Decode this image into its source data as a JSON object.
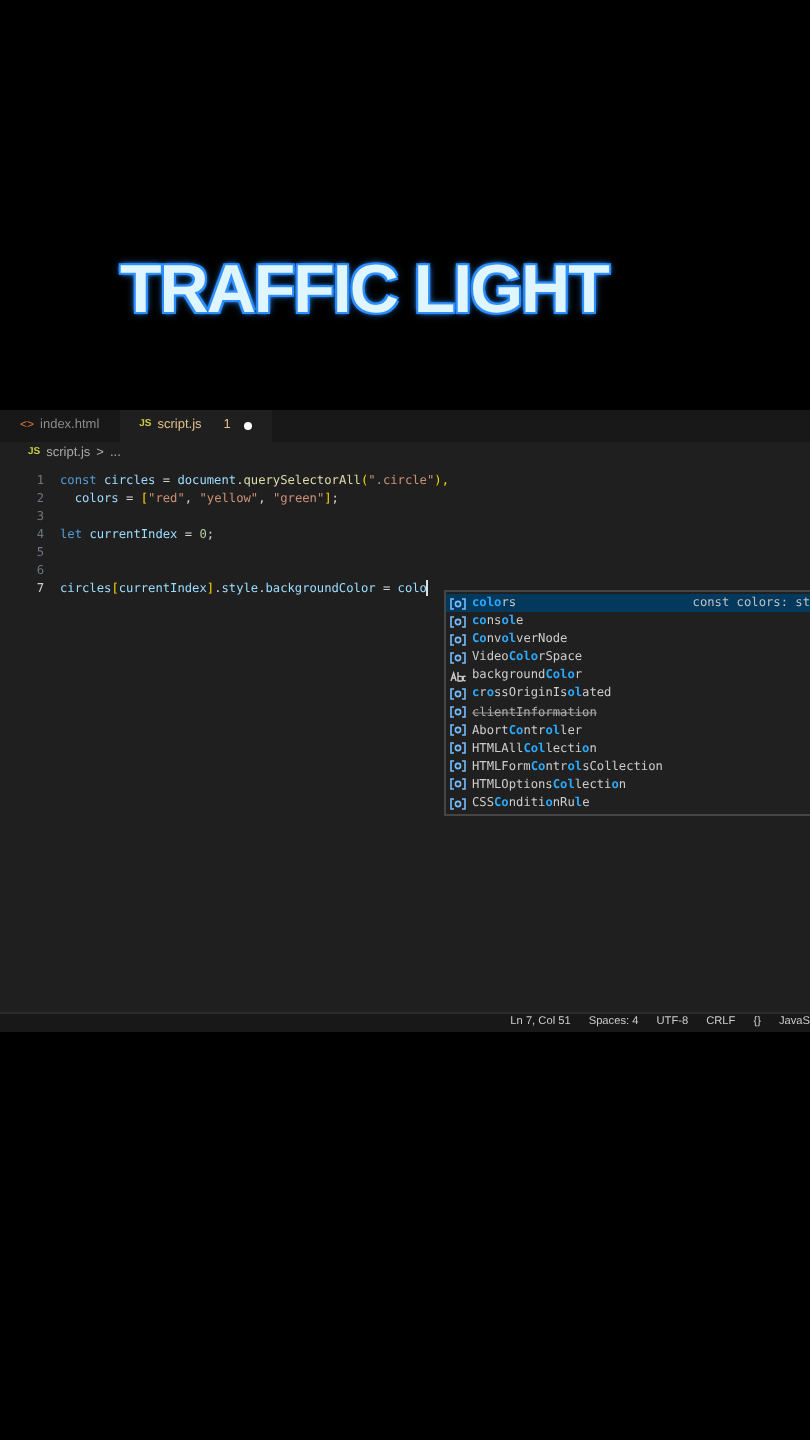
{
  "title": "TRAFFIC LIGHT",
  "tabs": [
    {
      "label": "index.html",
      "kind": "html",
      "icon": "<>",
      "selected": false
    },
    {
      "label": "script.js",
      "kind": "js",
      "icon": "JS",
      "selected": true,
      "problems": "1",
      "modified": true
    }
  ],
  "breadcrumb": {
    "icon": "JS",
    "file": "script.js",
    "separator": ">",
    "rest": "..."
  },
  "code": [
    {
      "number": "1",
      "active": false,
      "tokens": [
        {
          "text": "const ",
          "kind": "keyword"
        },
        {
          "text": "circles",
          "kind": "variable"
        },
        {
          "text": " = ",
          "kind": "plain"
        },
        {
          "text": "document",
          "kind": "variable"
        },
        {
          "text": ".",
          "kind": "plain"
        },
        {
          "text": "querySelectorAll",
          "kind": "function"
        },
        {
          "text": "(",
          "kind": "bracket"
        },
        {
          "text": "\".circle\"",
          "kind": "string"
        },
        {
          "text": "),",
          "kind": "bracket"
        }
      ]
    },
    {
      "number": "2",
      "active": false,
      "tokens": [
        {
          "text": "  colors",
          "kind": "variable"
        },
        {
          "text": " = ",
          "kind": "plain"
        },
        {
          "text": "[",
          "kind": "bracket"
        },
        {
          "text": "\"red\"",
          "kind": "string"
        },
        {
          "text": ", ",
          "kind": "plain"
        },
        {
          "text": "\"yellow\"",
          "kind": "string"
        },
        {
          "text": ", ",
          "kind": "plain"
        },
        {
          "text": "\"green\"",
          "kind": "string"
        },
        {
          "text": "]",
          "kind": "bracket"
        },
        {
          "text": ";",
          "kind": "plain"
        }
      ]
    },
    {
      "number": "3",
      "active": false
    },
    {
      "number": "4",
      "active": false,
      "tokens": [
        {
          "text": "let ",
          "kind": "keyword"
        },
        {
          "text": "currentIndex",
          "kind": "variable"
        },
        {
          "text": " = ",
          "kind": "plain"
        },
        {
          "text": "0",
          "kind": "number"
        },
        {
          "text": ";",
          "kind": "plain"
        }
      ]
    },
    {
      "number": "5",
      "active": false
    },
    {
      "number": "6",
      "active": false
    },
    {
      "number": "7",
      "active": true,
      "tokens": [
        {
          "text": "circles",
          "kind": "variable"
        },
        {
          "text": "[",
          "kind": "bracket"
        },
        {
          "text": "currentIndex",
          "kind": "variable"
        },
        {
          "text": "]",
          "kind": "bracket"
        },
        {
          "text": ".",
          "kind": "plain"
        },
        {
          "text": "style",
          "kind": "variable"
        },
        {
          "text": ".",
          "kind": "plain"
        },
        {
          "text": "backgroundColor",
          "kind": "variable"
        },
        {
          "text": " = ",
          "kind": "plain"
        },
        {
          "text": "colo",
          "kind": "variable"
        }
      ]
    }
  ],
  "suggestions": [
    {
      "kind": "variable",
      "selected": true,
      "deprecated": false,
      "detail": "const colors: st",
      "parts": [
        {
          "text": "colo",
          "match": true
        },
        {
          "text": "rs",
          "match": false
        }
      ]
    },
    {
      "kind": "variable",
      "selected": false,
      "deprecated": false,
      "parts": [
        {
          "text": "co",
          "match": true
        },
        {
          "text": "ns",
          "match": false
        },
        {
          "text": "ol",
          "match": true
        },
        {
          "text": "e",
          "match": false
        }
      ]
    },
    {
      "kind": "variable",
      "selected": false,
      "deprecated": false,
      "parts": [
        {
          "text": "Co",
          "match": true
        },
        {
          "text": "nv",
          "match": false
        },
        {
          "text": "ol",
          "match": true
        },
        {
          "text": "verNode",
          "match": false
        }
      ]
    },
    {
      "kind": "variable",
      "selected": false,
      "deprecated": false,
      "parts": [
        {
          "text": "Video",
          "match": false
        },
        {
          "text": "Colo",
          "match": true
        },
        {
          "text": "rSpace",
          "match": false
        }
      ]
    },
    {
      "kind": "text",
      "selected": false,
      "deprecated": false,
      "parts": [
        {
          "text": "background",
          "match": false
        },
        {
          "text": "Colo",
          "match": true
        },
        {
          "text": "r",
          "match": false
        }
      ]
    },
    {
      "kind": "variable",
      "selected": false,
      "deprecated": false,
      "parts": [
        {
          "text": "c",
          "match": true
        },
        {
          "text": "r",
          "match": false
        },
        {
          "text": "o",
          "match": true
        },
        {
          "text": "ssOriginIs",
          "match": false
        },
        {
          "text": "ol",
          "match": true
        },
        {
          "text": "ated",
          "match": false
        }
      ]
    },
    {
      "kind": "variable",
      "selected": false,
      "deprecated": true,
      "parts": [
        {
          "text": "clientInformation",
          "match": false
        }
      ]
    },
    {
      "kind": "variable",
      "selected": false,
      "deprecated": false,
      "parts": [
        {
          "text": "Abort",
          "match": false
        },
        {
          "text": "Co",
          "match": true
        },
        {
          "text": "ntr",
          "match": false
        },
        {
          "text": "ol",
          "match": true
        },
        {
          "text": "ler",
          "match": false
        }
      ]
    },
    {
      "kind": "variable",
      "selected": false,
      "deprecated": false,
      "parts": [
        {
          "text": "HTMLAll",
          "match": false
        },
        {
          "text": "Col",
          "match": true
        },
        {
          "text": "lecti",
          "match": false
        },
        {
          "text": "o",
          "match": true
        },
        {
          "text": "n",
          "match": false
        }
      ]
    },
    {
      "kind": "variable",
      "selected": false,
      "deprecated": false,
      "parts": [
        {
          "text": "HTMLForm",
          "match": false
        },
        {
          "text": "Co",
          "match": true
        },
        {
          "text": "ntr",
          "match": false
        },
        {
          "text": "ol",
          "match": true
        },
        {
          "text": "sCollection",
          "match": false
        }
      ]
    },
    {
      "kind": "variable",
      "selected": false,
      "deprecated": false,
      "parts": [
        {
          "text": "HTMLOptions",
          "match": false
        },
        {
          "text": "Col",
          "match": true
        },
        {
          "text": "lecti",
          "match": false
        },
        {
          "text": "o",
          "match": true
        },
        {
          "text": "n",
          "match": false
        }
      ]
    },
    {
      "kind": "variable",
      "selected": false,
      "deprecated": false,
      "parts": [
        {
          "text": "CSS",
          "match": false
        },
        {
          "text": "Co",
          "match": true
        },
        {
          "text": "nditi",
          "match": false
        },
        {
          "text": "o",
          "match": true
        },
        {
          "text": "nRu",
          "match": false
        },
        {
          "text": "l",
          "match": true
        },
        {
          "text": "e",
          "match": false
        }
      ]
    }
  ],
  "status_bar": [
    {
      "text": "Ln 7, Col 51"
    },
    {
      "text": "Spaces: 4"
    },
    {
      "text": "UTF-8"
    },
    {
      "text": "CRLF"
    },
    {
      "text": "{}"
    },
    {
      "text": "JavaS"
    }
  ]
}
